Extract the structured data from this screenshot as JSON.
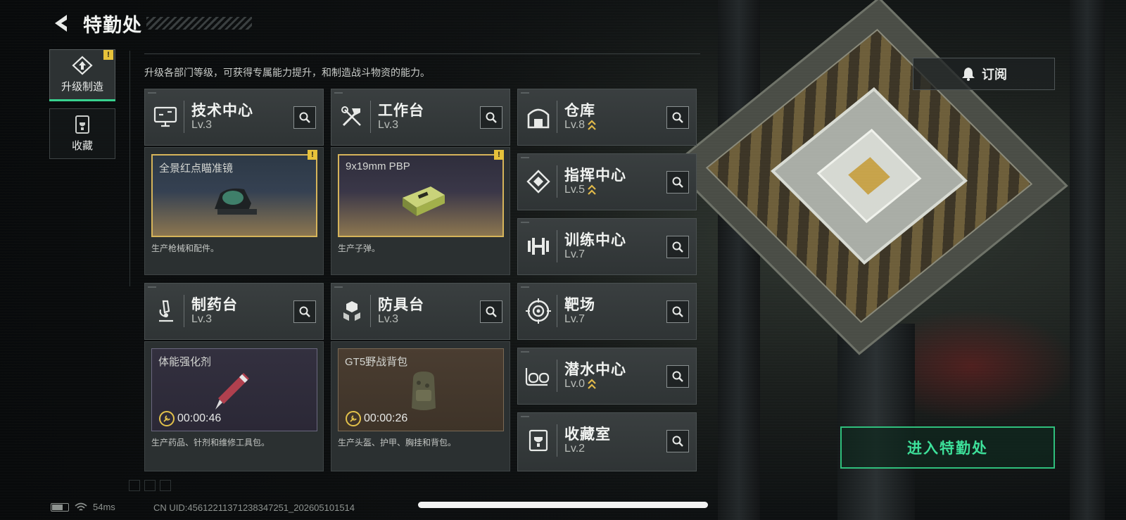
{
  "header": {
    "title": "特勤处"
  },
  "tabs": [
    {
      "label": "升级制造",
      "active": true,
      "alert": "!"
    },
    {
      "label": "收藏",
      "active": false
    }
  ],
  "description": "升级各部门等级，可获得专属能力提升，和制造战斗物资的能力。",
  "departments": [
    {
      "name": "技术中心",
      "level": "Lv.3",
      "icon": "computer-icon"
    },
    {
      "name": "工作台",
      "level": "Lv.3",
      "icon": "hammer-wrench-icon"
    },
    {
      "name": "制药台",
      "level": "Lv.3",
      "icon": "microscope-icon"
    },
    {
      "name": "防具台",
      "level": "Lv.3",
      "icon": "armor-blocks-icon"
    },
    {
      "name": "仓库",
      "level": "Lv.8",
      "icon": "warehouse-icon",
      "upgradable": true
    },
    {
      "name": "指挥中心",
      "level": "Lv.5",
      "icon": "command-icon",
      "upgradable": true
    },
    {
      "name": "训练中心",
      "level": "Lv.7",
      "icon": "dumbbell-icon"
    },
    {
      "name": "靶场",
      "level": "Lv.7",
      "icon": "target-icon"
    },
    {
      "name": "潜水中心",
      "level": "Lv.0",
      "icon": "diving-mask-icon",
      "upgradable": true
    },
    {
      "name": "收藏室",
      "level": "Lv.2",
      "icon": "collection-icon"
    }
  ],
  "productions": [
    {
      "item": "全景红点瞄准镜",
      "desc": "生产枪械和配件。",
      "alert": "!"
    },
    {
      "item": "9x19mm PBP",
      "desc": "生产子弹。",
      "alert": "!"
    },
    {
      "item": "体能强化剂",
      "desc": "生产药品、针剂和维修工具包。",
      "timer": "00:00:46"
    },
    {
      "item": "GT5野战背包",
      "desc": "生产头盔、护甲、胸挂和背包。",
      "timer": "00:00:26"
    }
  ],
  "subscribe": {
    "label": "订阅"
  },
  "enter": {
    "label": "进入特勤处"
  },
  "status": {
    "ping": "54ms",
    "uid": "CN UID:4561221137123834725​1_202605101514"
  },
  "colors": {
    "accent_green": "#3de09a",
    "alert_yellow": "#e6c23a",
    "gold_frame": "#d6b45a"
  }
}
